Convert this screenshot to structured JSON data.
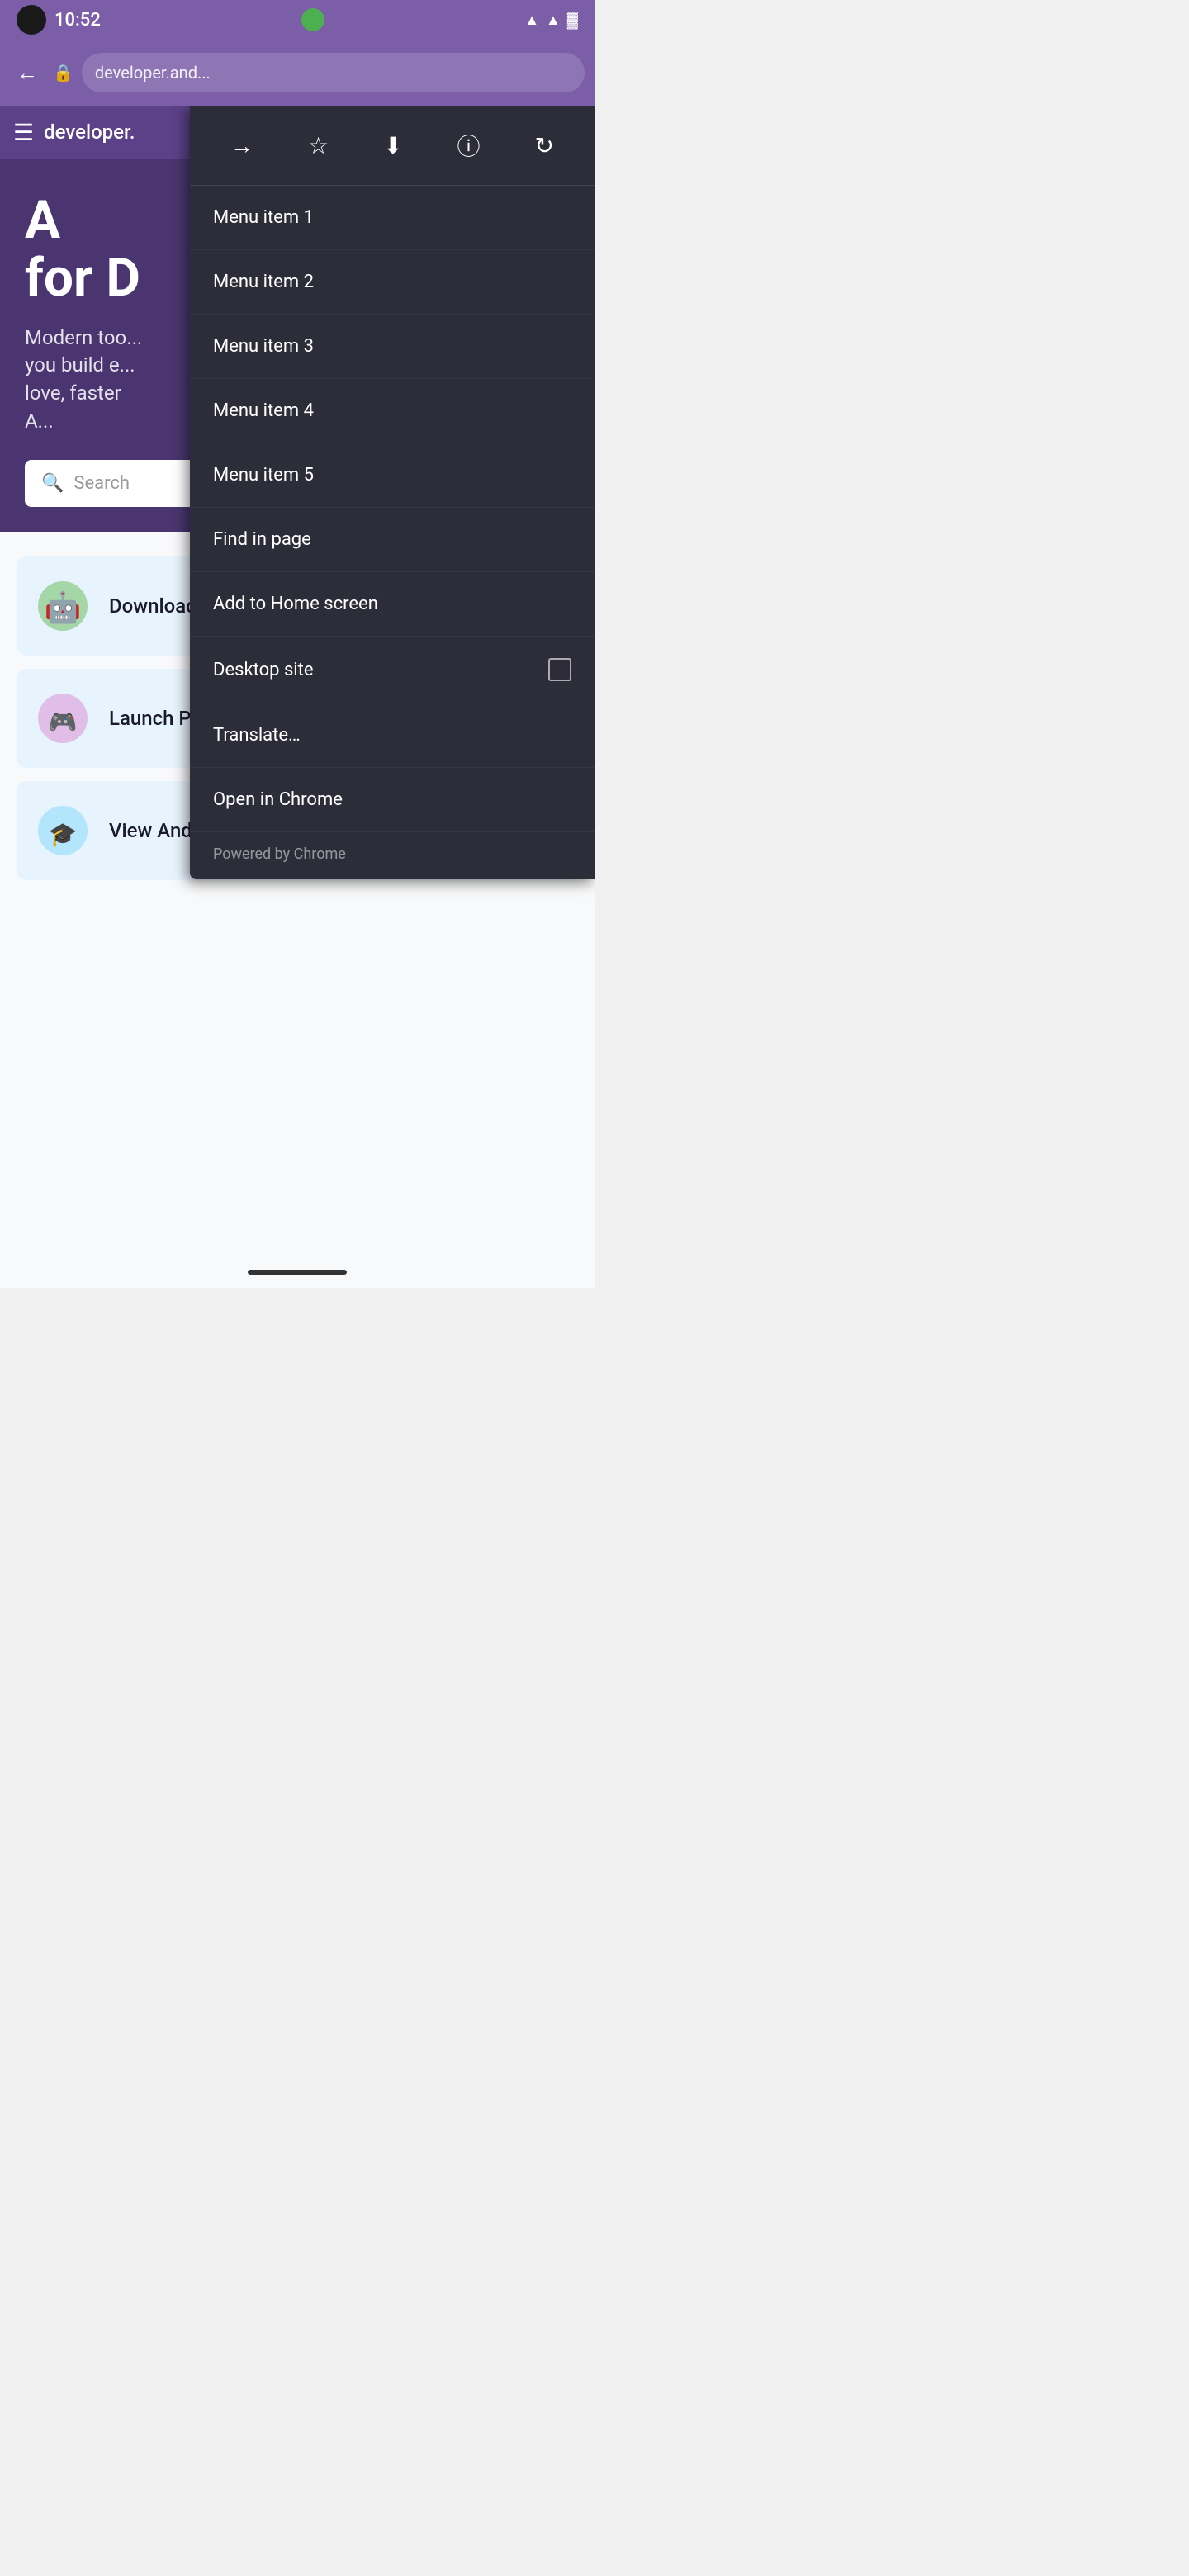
{
  "statusBar": {
    "time": "10:52"
  },
  "browserChrome": {
    "urlText": "developer.and..."
  },
  "pageNavbar": {
    "logoText": "developer."
  },
  "hero": {
    "titleLine1": "A",
    "titleLine2": "for D",
    "subtitleLine1": "Modern too...",
    "subtitleLine2": "you build e...",
    "subtitleLine3": "love, faster",
    "subtitleLine4": "A..."
  },
  "searchBar": {
    "placeholder": "Search"
  },
  "cards": [
    {
      "title": "Download Android Studio",
      "iconType": "android",
      "actionIcon": "download"
    },
    {
      "title": "Launch Play Console",
      "iconType": "play",
      "actionIcon": "external-link"
    },
    {
      "title": "View Android courses",
      "iconType": "graduation",
      "actionIcon": "none"
    }
  ],
  "dropdownMenu": {
    "toolbar": {
      "forwardIcon": "→",
      "bookmarkIcon": "☆",
      "downloadIcon": "⬇",
      "infoIcon": "ⓘ",
      "refreshIcon": "↻"
    },
    "items": [
      {
        "label": "Menu item 1",
        "hasCheckbox": false
      },
      {
        "label": "Menu item 2",
        "hasCheckbox": false
      },
      {
        "label": "Menu item 3",
        "hasCheckbox": false
      },
      {
        "label": "Menu item 4",
        "hasCheckbox": false
      },
      {
        "label": "Menu item 5",
        "hasCheckbox": false
      },
      {
        "label": "Find in page",
        "hasCheckbox": false
      },
      {
        "label": "Add to Home screen",
        "hasCheckbox": false
      },
      {
        "label": "Desktop site",
        "hasCheckbox": true
      },
      {
        "label": "Translate…",
        "hasCheckbox": false
      },
      {
        "label": "Open in Chrome",
        "hasCheckbox": false
      }
    ],
    "footer": "Powered by Chrome"
  }
}
